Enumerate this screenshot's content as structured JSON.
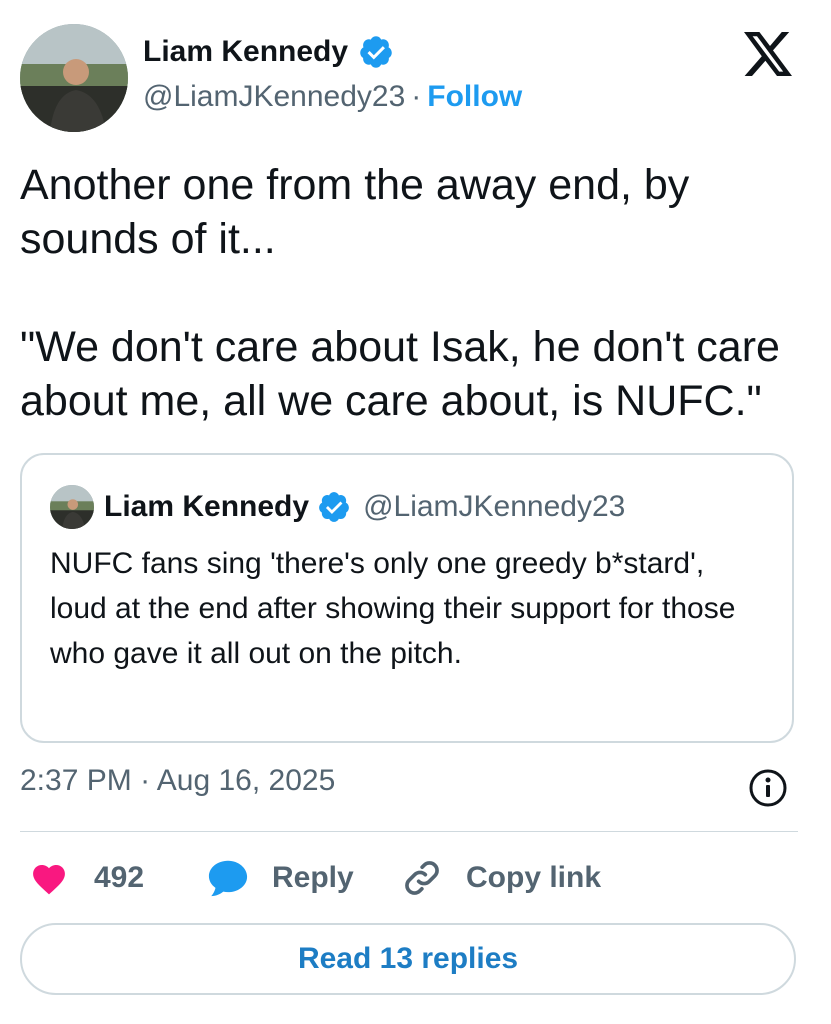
{
  "author": {
    "name": "Liam Kennedy",
    "handle": "@LiamJKennedy23",
    "separator": "·",
    "follow_label": "Follow"
  },
  "brand": {
    "logo_icon": "x-logo-icon"
  },
  "tweet": {
    "text": "Another one from the away end, by\nsounds of it...\n\n\"We don't care about Isak, he don't care\nabout me, all we care about, is NUFC.\""
  },
  "quoted_tweet": {
    "name": "Liam Kennedy",
    "handle": "@LiamJKennedy23",
    "text": "NUFC fans sing 'there's only one greedy b*stard', loud at the end after showing their support for those who gave it all out on the pitch."
  },
  "timestamp": {
    "time": "2:37 PM",
    "separator": "·",
    "date": "Aug 16, 2025"
  },
  "actions": {
    "like_count": "492",
    "reply_label": "Reply",
    "copy_label": "Copy link"
  },
  "read_replies_label": "Read 13 replies",
  "colors": {
    "accent": "#1d9bf0",
    "like": "#f91880",
    "muted": "#536471",
    "border": "#cfd9de"
  }
}
